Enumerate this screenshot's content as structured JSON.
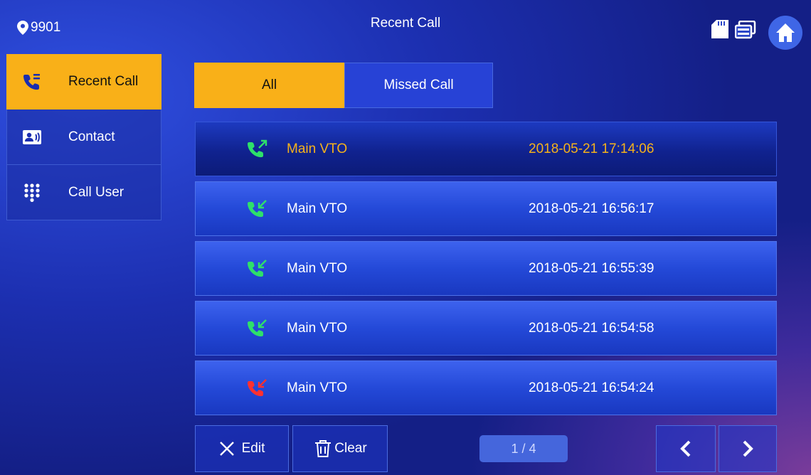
{
  "header": {
    "location": "9901",
    "title": "Recent Call"
  },
  "sidebar": {
    "items": [
      {
        "label": "Recent Call",
        "icon": "phone-list-icon",
        "active": true
      },
      {
        "label": "Contact",
        "icon": "contact-card-icon",
        "active": false
      },
      {
        "label": "Call User",
        "icon": "keypad-icon",
        "active": false
      }
    ]
  },
  "tabs": [
    {
      "label": "All",
      "active": true
    },
    {
      "label": "Missed Call",
      "active": false
    }
  ],
  "calls": [
    {
      "name": "Main VTO",
      "time": "2018-05-21 17:14:06",
      "type": "outgoing",
      "selected": true
    },
    {
      "name": "Main VTO",
      "time": "2018-05-21 16:56:17",
      "type": "incoming",
      "selected": false
    },
    {
      "name": "Main VTO",
      "time": "2018-05-21 16:55:39",
      "type": "incoming",
      "selected": false
    },
    {
      "name": "Main VTO",
      "time": "2018-05-21 16:54:58",
      "type": "incoming",
      "selected": false
    },
    {
      "name": "Main VTO",
      "time": "2018-05-21 16:54:24",
      "type": "missed",
      "selected": false
    }
  ],
  "footer": {
    "edit_label": "Edit",
    "clear_label": "Clear",
    "page": "1 / 4"
  },
  "colors": {
    "accent": "#f9b018",
    "answered": "#2ee06a",
    "missed": "#ff3030",
    "background": "#1c2fb0"
  }
}
